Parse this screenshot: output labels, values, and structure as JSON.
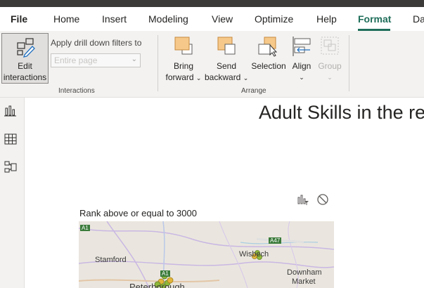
{
  "tabs": [
    {
      "label": "File"
    },
    {
      "label": "Home"
    },
    {
      "label": "Insert"
    },
    {
      "label": "Modeling"
    },
    {
      "label": "View"
    },
    {
      "label": "Optimize"
    },
    {
      "label": "Help"
    },
    {
      "label": "Format"
    },
    {
      "label": "Da"
    }
  ],
  "ribbon": {
    "edit_interactions": {
      "line1": "Edit",
      "line2": "interactions"
    },
    "apply_drill_label": "Apply drill down filters to",
    "drill_select_value": "Entire page",
    "interactions_group": "Interactions",
    "bring_forward": {
      "line1": "Bring",
      "line2": "forward"
    },
    "send_backward": {
      "line1": "Send",
      "line2": "backward"
    },
    "selection": "Selection",
    "align": "Align",
    "group": "Group",
    "arrange_group": "Arrange"
  },
  "report": {
    "title": "Adult Skills in the re",
    "map_title": "Rank above or equal to 3000",
    "map_labels": {
      "a1_top": "A1",
      "a47": "A47",
      "stamford": "Stamford",
      "wisbech": "Wisbech",
      "downham1": "Downham",
      "downham2": "Market",
      "a1_mid": "A1",
      "peterborough": "Peterborough"
    }
  },
  "colors": {
    "accent": "#1f6e5a",
    "ribbon_bg": "#f3f2f1",
    "map_marker": "#8fb83a",
    "map_marker_alt": "#e2b53a"
  }
}
